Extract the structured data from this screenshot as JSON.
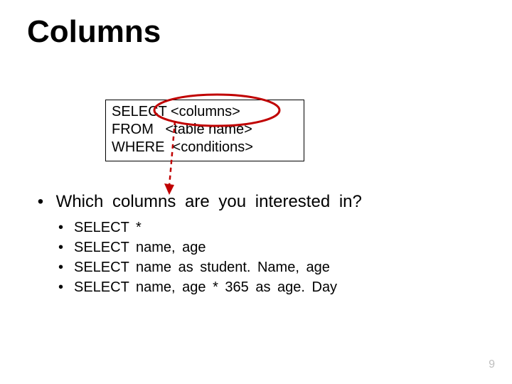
{
  "title": "Columns",
  "sql": {
    "line1": "SELECT <columns>",
    "line2": "FROM   <table name>",
    "line3": "WHERE  <conditions>"
  },
  "question": {
    "bullet": "•",
    "text": "Which  columns  are  you  interested  in?"
  },
  "examples": {
    "bullet": "•",
    "items": [
      "SELECT *",
      "SELECT name,  age",
      "SELECT name  as  student. Name,  age",
      "SELECT name,  age  *  365  as  age. Day"
    ]
  },
  "pageNumber": "9"
}
